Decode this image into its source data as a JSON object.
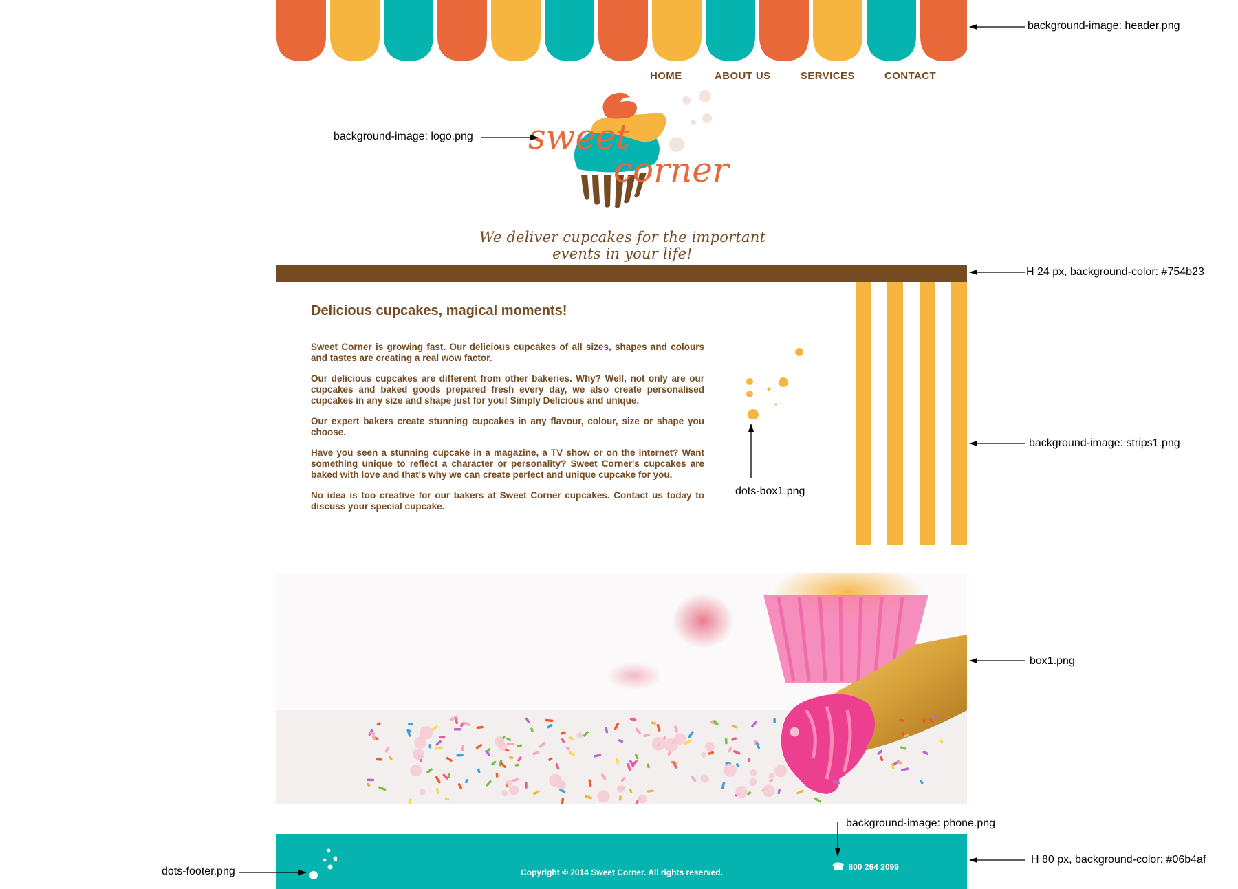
{
  "colors": {
    "orange": "#e9683a",
    "yellow": "#f5b53f",
    "teal": "#06b4af",
    "brown": "#754b23",
    "footer_bg": "#06b4af"
  },
  "nav": {
    "items": [
      {
        "label": "HOME"
      },
      {
        "label": "ABOUT US"
      },
      {
        "label": "SERVICES"
      },
      {
        "label": "CONTACT"
      }
    ]
  },
  "logo": {
    "word1": "sweet",
    "word2": "corner"
  },
  "tagline": "We deliver cupcakes for the important events in your life!",
  "content": {
    "title": "Delicious cupcakes, magical moments!",
    "paragraphs": [
      "Sweet Corner is growing fast. Our delicious cupcakes of all sizes, shapes and colours and tastes are creating a real wow factor.",
      "Our delicious cupcakes are different from other bakeries. Why? Well, not only are our cupcakes and baked goods prepared fresh every day, we also create personalised cupcakes in any size and shape just for you! Simply Delicious and unique.",
      "Our expert bakers create stunning cupcakes in any flavour, colour, size or shape you choose.",
      "Have you seen a stunning cupcake in a magazine, a TV show or on the internet? Want something unique to reflect a character or personality? Sweet Corner's cupcakes are baked with love and that's why we can create perfect and unique cupcake for you.",
      "No idea is too creative for our bakers at Sweet Corner cupcakes. Contact us today to discuss your special cupcake."
    ]
  },
  "footer": {
    "copyright": "Copyright © 2014 Sweet Corner. All rights reserved.",
    "phone": "800 264 2099",
    "phone_icon": "phone-icon"
  },
  "annotations": {
    "header": "background-image: header.png",
    "logo": "background-image: logo.png",
    "brownbar": "H 24 px, background-color: #754b23",
    "strips": "background-image: strips1.png",
    "dots_box": "dots-box1.png",
    "box1": "box1.png",
    "phone": "background-image: phone.png",
    "dots_footer": "dots-footer.png",
    "footer": "H 80 px, background-color: #06b4af"
  }
}
